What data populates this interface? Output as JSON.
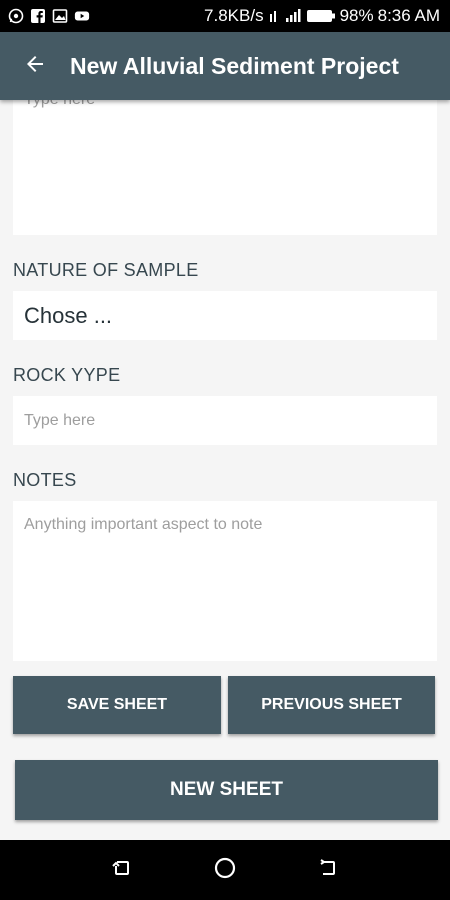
{
  "status_bar": {
    "network_speed": "7.8KB/s",
    "battery": "98%",
    "time": "8:36 AM",
    "icons": [
      "whatsapp-icon",
      "facebook-icon",
      "gallery-icon",
      "youtube-icon",
      "signal-icon",
      "battery-icon"
    ]
  },
  "app_bar": {
    "title": "New Alluvial Sediment Project",
    "back_icon": "arrow-back-icon"
  },
  "form": {
    "top_field_placeholder": "Type here",
    "nature_label": "NATURE OF SAMPLE",
    "nature_value": "Chose ...",
    "rock_label": "ROCK YYPE",
    "rock_placeholder": "Type here",
    "notes_label": "NOTES",
    "notes_placeholder": "Anything important aspect to note"
  },
  "buttons": {
    "save": "SAVE SHEET",
    "previous": "PREVIOUS SHEET",
    "new": "NEW SHEET"
  },
  "colors": {
    "primary": "#455a64",
    "background": "#f5f5f5"
  }
}
